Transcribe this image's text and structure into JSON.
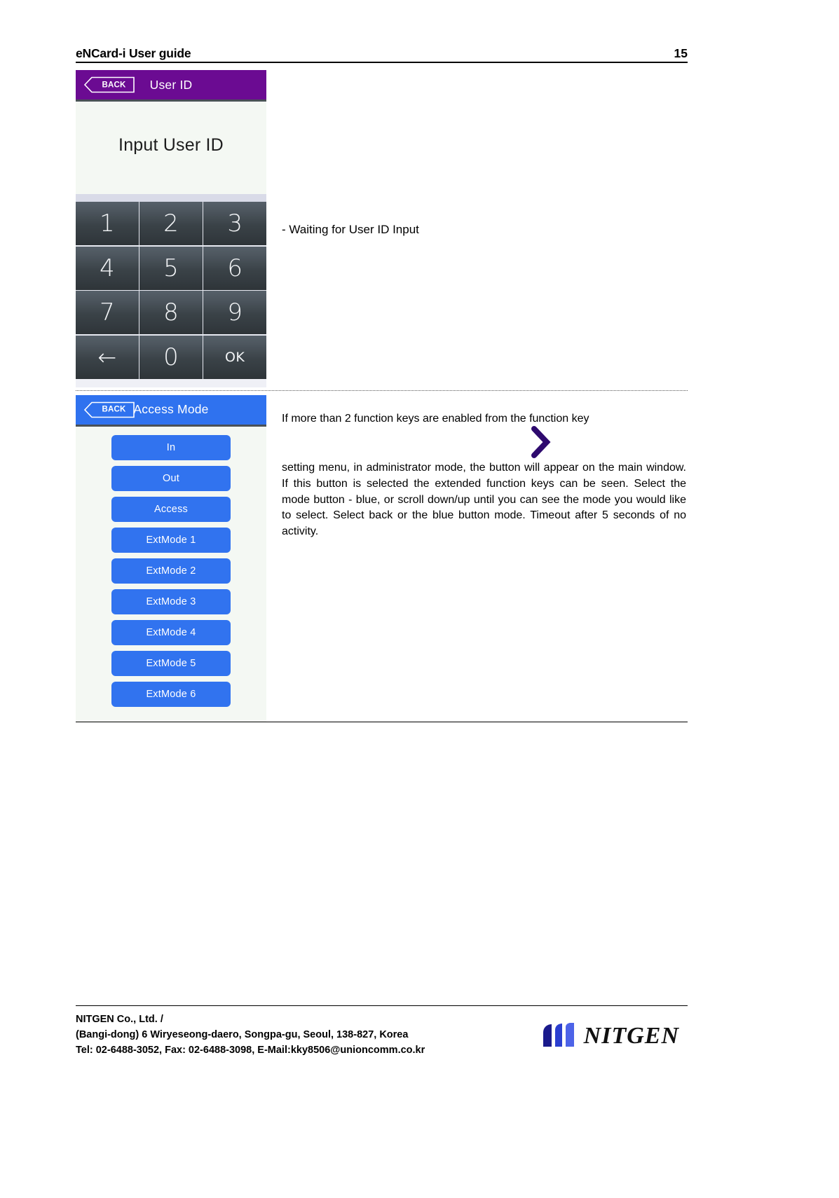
{
  "header": {
    "doc_title": "eNCard-i User guide",
    "page_number": "15"
  },
  "figure_userid": {
    "titlebar": {
      "back_label": "BACK",
      "title": "User ID",
      "background_color": "#6b0b92"
    },
    "prompt": "Input User ID",
    "keypad": [
      {
        "key": "1",
        "name": "key-1"
      },
      {
        "key": "2",
        "name": "key-2"
      },
      {
        "key": "3",
        "name": "key-3"
      },
      {
        "key": "4",
        "name": "key-4"
      },
      {
        "key": "5",
        "name": "key-5"
      },
      {
        "key": "6",
        "name": "key-6"
      },
      {
        "key": "7",
        "name": "key-7"
      },
      {
        "key": "8",
        "name": "key-8"
      },
      {
        "key": "9",
        "name": "key-9"
      },
      {
        "key": "←",
        "name": "key-backspace"
      },
      {
        "key": "0",
        "name": "key-0"
      },
      {
        "key": "OK",
        "name": "key-ok"
      }
    ],
    "caption": "- Waiting for User ID Input"
  },
  "figure_access_mode": {
    "titlebar": {
      "back_label": "BACK",
      "title": "Access Mode",
      "background_color": "#3173ef"
    },
    "mode_buttons": [
      "In",
      "Out",
      "Access",
      "ExtMode 1",
      "ExtMode 2",
      "ExtMode 3",
      "ExtMode 4",
      "ExtMode 5",
      "ExtMode 6"
    ],
    "caption_line1": "If more than 2 function keys are enabled from the function key",
    "caption_body": "setting menu, in administrator mode, the          button will appear on the main window. If this button is selected the extended function keys can be seen. Select the mode button - blue, or scroll down/up until you can see the mode you would like to select. Select back or the blue button mode. Timeout after 5 seconds of no activity.",
    "inline_icon": "chevron-right-icon",
    "inline_icon_color": "#2e0a6e"
  },
  "footer": {
    "line1": "NITGEN Co., Ltd. /",
    "line2": "(Bangi-dong) 6 Wiryeseong-daero, Songpa-gu, Seoul, 138-827, Korea",
    "line3": "Tel: 02-6488-3052, Fax: 02-6488-3098, E-Mail:kky8506@unioncomm.co.kr",
    "logo_text": "NITGEN"
  }
}
